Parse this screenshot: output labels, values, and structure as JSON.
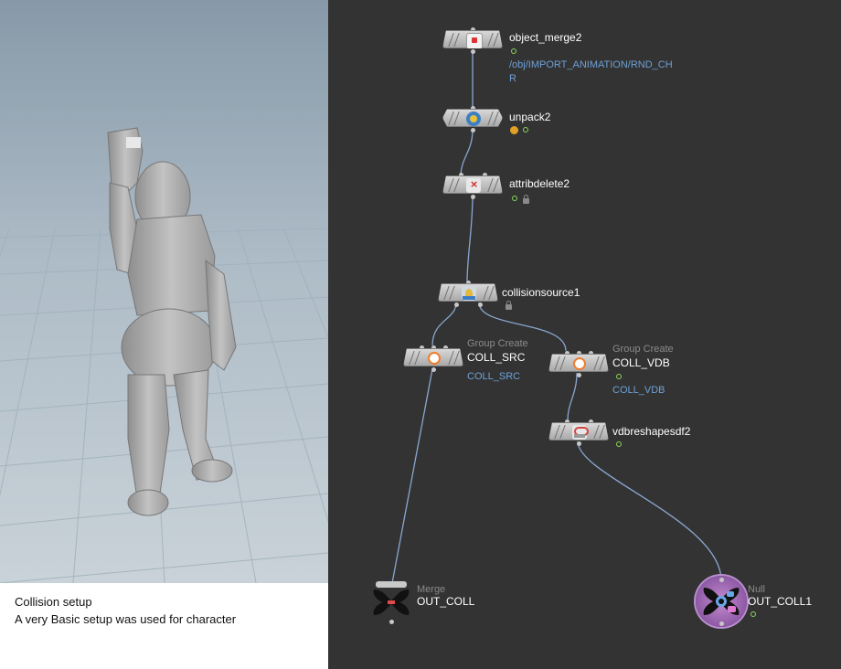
{
  "caption": {
    "title": "Collision setup",
    "subtitle": "A very Basic setup was used for character"
  },
  "colors": {
    "network_bg": "#333333",
    "viewport_sky": "#a9b8c4",
    "param_text": "#6ea0d6",
    "flag_ok": "#8bd65a",
    "flag_warn": "#e0a126"
  },
  "nodes": {
    "object_merge2": {
      "name": "object_merge2",
      "param": "/obj/IMPORT_ANIMATION/RND_CH\nR",
      "icon": "object-merge-icon"
    },
    "unpack2": {
      "name": "unpack2",
      "icon": "unpack-icon"
    },
    "attribdelete2": {
      "name": "attribdelete2",
      "icon": "attribute-delete-icon"
    },
    "collisionsource1": {
      "name": "collisionsource1",
      "icon": "collision-source-icon"
    },
    "coll_src": {
      "type": "Group Create",
      "name": "COLL_SRC",
      "param": "COLL_SRC",
      "icon": "group-create-icon"
    },
    "coll_vdb": {
      "type": "Group Create",
      "name": "COLL_VDB",
      "param": "COLL_VDB",
      "icon": "group-create-icon"
    },
    "vdbreshapesdf2": {
      "name": "vdbreshapesdf2",
      "icon": "vdb-reshape-icon"
    },
    "out_coll": {
      "type": "Merge",
      "name": "OUT_COLL",
      "icon": "merge-icon"
    },
    "out_coll1": {
      "type": "Null",
      "name": "OUT_COLL1",
      "icon": "null-icon"
    }
  }
}
